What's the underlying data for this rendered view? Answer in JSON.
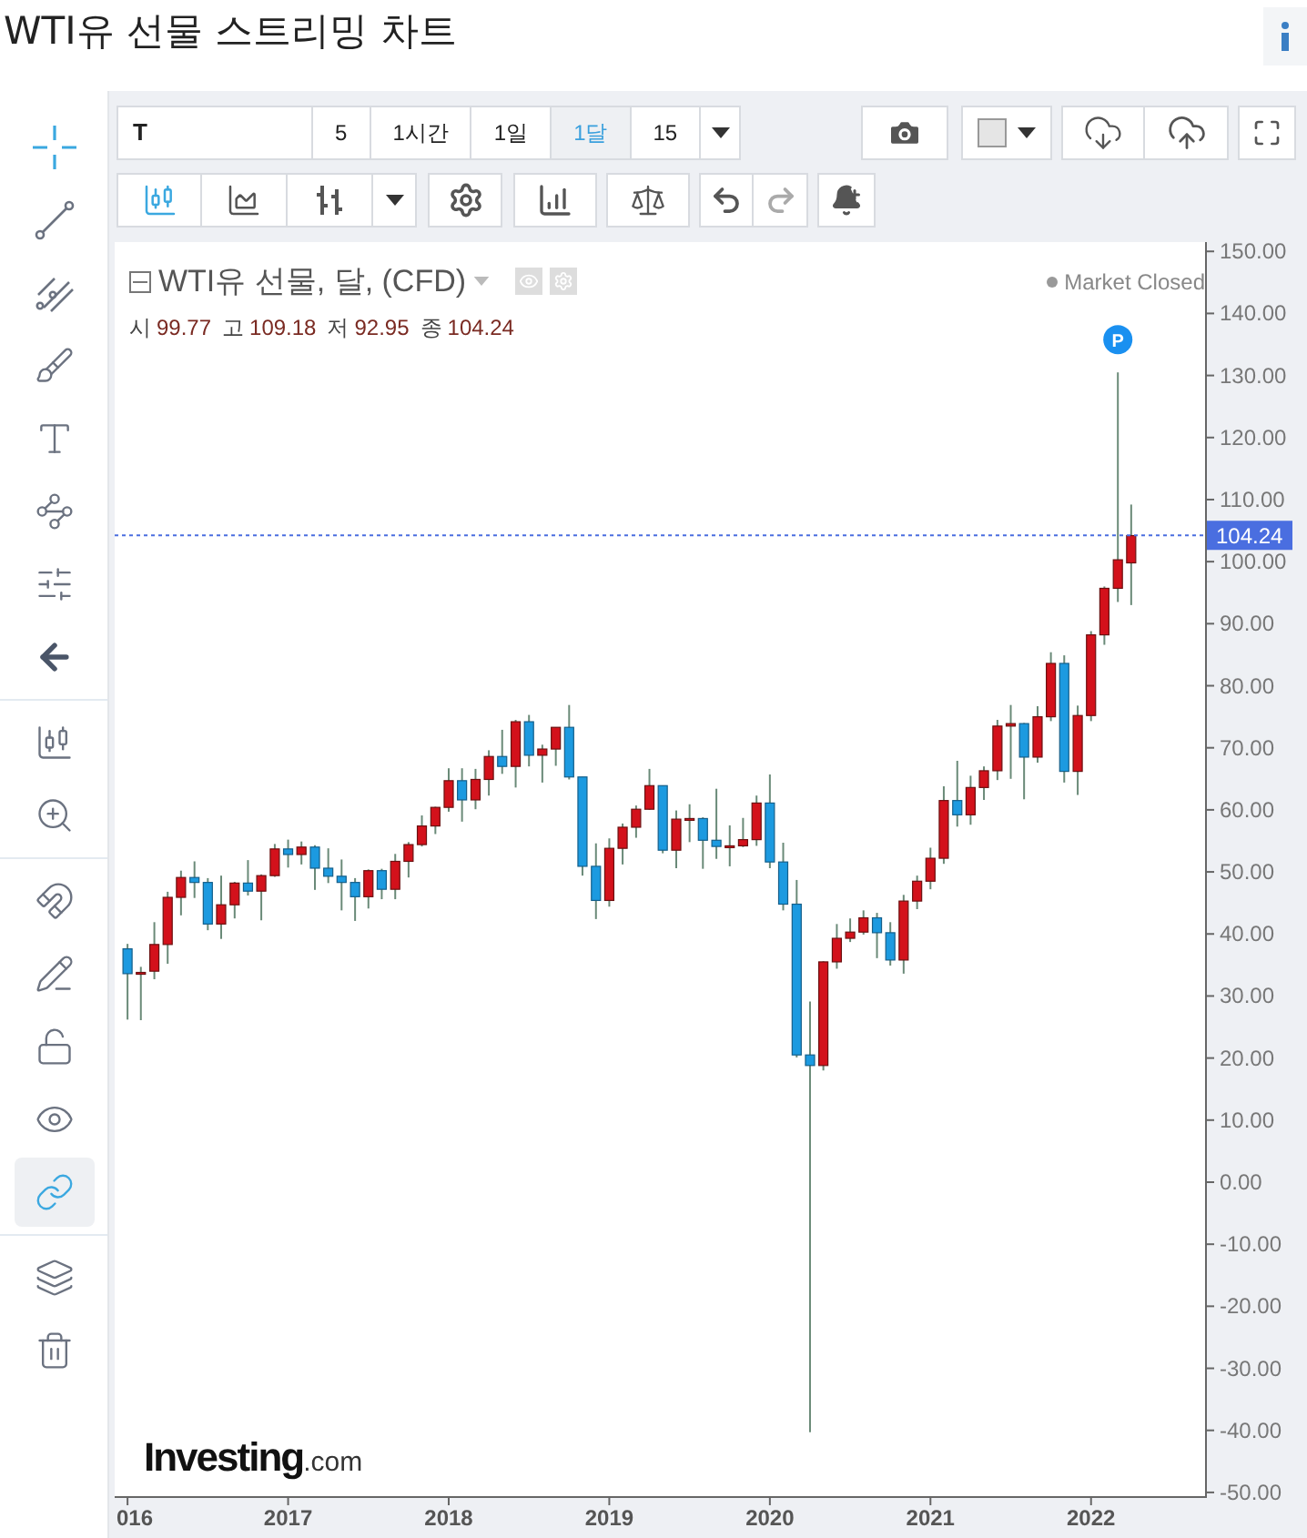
{
  "page_title": "WTI유 선물 스트리밍 차트",
  "sidebar": {
    "groups": [
      {
        "items": [
          {
            "kind": "crosshair",
            "selected": true
          },
          {
            "kind": "trend-line",
            "selected": false
          },
          {
            "kind": "pitchfork",
            "selected": false
          },
          {
            "kind": "brush",
            "selected": false
          },
          {
            "kind": "text",
            "selected": false
          },
          {
            "kind": "pattern",
            "selected": false
          },
          {
            "kind": "fibonacci",
            "selected": false
          },
          {
            "kind": "hide",
            "selected": false
          }
        ]
      },
      {
        "items": [
          {
            "kind": "measure",
            "selected": false
          },
          {
            "kind": "zoom",
            "selected": false
          }
        ]
      },
      {
        "items": [
          {
            "kind": "magnet",
            "on": false
          },
          {
            "kind": "lock-drawing",
            "on": false
          },
          {
            "kind": "lock",
            "on": false
          },
          {
            "kind": "visibility",
            "on": false
          },
          {
            "kind": "link",
            "on": true
          }
        ]
      },
      {
        "items": [
          {
            "kind": "layers"
          },
          {
            "kind": "trash"
          }
        ]
      }
    ]
  },
  "toolbar": {
    "symbol": "T",
    "intervals": [
      {
        "label": "5",
        "selected": false
      },
      {
        "label": "1시간",
        "selected": false
      },
      {
        "label": "1일",
        "selected": false
      },
      {
        "label": "1달",
        "selected": true
      },
      {
        "label": "15",
        "selected": false
      }
    ],
    "chart_types": [
      {
        "kind": "candles",
        "selected": true
      },
      {
        "kind": "area",
        "selected": false
      },
      {
        "kind": "bars",
        "selected": false
      }
    ],
    "undo": {
      "disabled": false
    },
    "redo": {
      "disabled": true
    }
  },
  "legend": {
    "title": "WTI유 선물, 달, (CFD)",
    "status": "Market Closed",
    "ohlc": [
      {
        "label": "시",
        "value": "99.77"
      },
      {
        "label": "고",
        "value": "109.18"
      },
      {
        "label": "저",
        "value": "92.95"
      },
      {
        "label": "종",
        "value": "104.24"
      }
    ]
  },
  "logo": {
    "name": "Investing",
    "suffix": ".com"
  },
  "badge": {
    "label": "P"
  },
  "x_axis_edge_label": "016",
  "chart_data": {
    "type": "candlestick",
    "x": [
      2016.0,
      2016.083,
      2016.167,
      2016.25,
      2016.333,
      2016.417,
      2016.5,
      2016.583,
      2016.667,
      2016.75,
      2016.833,
      2016.917,
      2017.0,
      2017.083,
      2017.167,
      2017.25,
      2017.333,
      2017.417,
      2017.5,
      2017.583,
      2017.667,
      2017.75,
      2017.833,
      2017.917,
      2018.0,
      2018.083,
      2018.167,
      2018.25,
      2018.333,
      2018.417,
      2018.5,
      2018.583,
      2018.667,
      2018.75,
      2018.833,
      2018.917,
      2019.0,
      2019.083,
      2019.167,
      2019.25,
      2019.333,
      2019.417,
      2019.5,
      2019.583,
      2019.667,
      2019.75,
      2019.833,
      2019.917,
      2020.0,
      2020.083,
      2020.167,
      2020.25,
      2020.333,
      2020.417,
      2020.5,
      2020.583,
      2020.667,
      2020.75,
      2020.833,
      2020.917,
      2021.0,
      2021.083,
      2021.167,
      2021.25,
      2021.333,
      2021.417,
      2021.5,
      2021.583,
      2021.667,
      2021.75,
      2021.833,
      2021.917,
      2022.0,
      2022.083,
      2022.167,
      2022.25
    ],
    "xlim": [
      2015.92,
      2022.71
    ],
    "ohlc": [
      [
        37.6,
        38.4,
        26.2,
        33.6
      ],
      [
        33.6,
        34.7,
        26.1,
        33.8
      ],
      [
        34.0,
        41.9,
        32.7,
        38.3
      ],
      [
        38.3,
        46.8,
        35.2,
        45.9
      ],
      [
        45.9,
        50.2,
        43.0,
        49.1
      ],
      [
        49.1,
        51.7,
        45.8,
        48.3
      ],
      [
        48.3,
        49.0,
        40.6,
        41.6
      ],
      [
        41.6,
        49.4,
        39.2,
        44.7
      ],
      [
        44.7,
        48.4,
        42.5,
        48.2
      ],
      [
        48.2,
        51.9,
        46.2,
        46.9
      ],
      [
        46.9,
        49.6,
        42.2,
        49.4
      ],
      [
        49.4,
        54.5,
        49.2,
        53.7
      ],
      [
        53.7,
        55.2,
        50.7,
        52.8
      ],
      [
        52.8,
        54.9,
        51.2,
        54.0
      ],
      [
        54.0,
        54.3,
        47.1,
        50.6
      ],
      [
        50.6,
        53.8,
        48.2,
        49.3
      ],
      [
        49.3,
        52.0,
        43.8,
        48.3
      ],
      [
        48.3,
        49.0,
        42.1,
        46.0
      ],
      [
        46.0,
        50.4,
        44.1,
        50.2
      ],
      [
        50.2,
        50.5,
        45.6,
        47.2
      ],
      [
        47.2,
        52.9,
        45.6,
        51.7
      ],
      [
        51.7,
        54.8,
        49.1,
        54.4
      ],
      [
        54.4,
        59.1,
        54.1,
        57.4
      ],
      [
        57.4,
        60.5,
        56.1,
        60.4
      ],
      [
        60.4,
        66.7,
        59.7,
        64.7
      ],
      [
        64.7,
        66.7,
        58.1,
        61.6
      ],
      [
        61.6,
        66.6,
        60.1,
        64.9
      ],
      [
        64.9,
        69.6,
        62.3,
        68.6
      ],
      [
        68.6,
        72.9,
        65.8,
        67.0
      ],
      [
        67.0,
        74.5,
        63.6,
        74.2
      ],
      [
        74.2,
        75.3,
        67.0,
        68.8
      ],
      [
        68.8,
        70.5,
        64.4,
        69.8
      ],
      [
        69.8,
        73.3,
        67.1,
        73.3
      ],
      [
        73.3,
        76.9,
        64.9,
        65.3
      ],
      [
        65.3,
        65.3,
        49.4,
        50.9
      ],
      [
        50.9,
        54.6,
        42.4,
        45.4
      ],
      [
        45.4,
        55.4,
        44.4,
        53.8
      ],
      [
        53.8,
        57.8,
        51.2,
        57.2
      ],
      [
        57.2,
        60.7,
        55.5,
        60.1
      ],
      [
        60.1,
        66.6,
        60.0,
        63.9
      ],
      [
        63.9,
        63.9,
        53.0,
        53.5
      ],
      [
        53.5,
        59.9,
        50.6,
        58.5
      ],
      [
        58.5,
        60.9,
        54.8,
        58.6
      ],
      [
        58.6,
        58.8,
        50.5,
        55.1
      ],
      [
        55.1,
        63.4,
        52.1,
        54.1
      ],
      [
        54.1,
        57.5,
        50.9,
        54.2
      ],
      [
        54.2,
        58.7,
        54.0,
        55.2
      ],
      [
        55.2,
        62.3,
        54.2,
        61.1
      ],
      [
        61.1,
        65.7,
        50.6,
        51.6
      ],
      [
        51.6,
        54.7,
        43.8,
        44.8
      ],
      [
        44.8,
        48.7,
        20.1,
        20.5
      ],
      [
        20.5,
        29.1,
        -40.3,
        18.8
      ],
      [
        18.8,
        35.6,
        18.0,
        35.5
      ],
      [
        35.5,
        41.6,
        34.4,
        39.3
      ],
      [
        39.3,
        42.5,
        38.7,
        40.3
      ],
      [
        40.3,
        43.8,
        39.9,
        42.6
      ],
      [
        42.6,
        43.4,
        36.1,
        40.2
      ],
      [
        40.2,
        41.9,
        34.9,
        35.8
      ],
      [
        35.8,
        46.3,
        33.6,
        45.3
      ],
      [
        45.3,
        49.4,
        44.0,
        48.5
      ],
      [
        48.5,
        53.9,
        47.2,
        52.2
      ],
      [
        52.2,
        63.8,
        51.3,
        61.5
      ],
      [
        61.5,
        67.9,
        57.3,
        59.2
      ],
      [
        59.2,
        65.5,
        57.6,
        63.6
      ],
      [
        63.6,
        67.0,
        61.6,
        66.3
      ],
      [
        66.3,
        74.5,
        64.8,
        73.5
      ],
      [
        73.5,
        76.9,
        65.0,
        73.9
      ],
      [
        73.9,
        74.0,
        61.7,
        68.5
      ],
      [
        68.5,
        76.7,
        67.6,
        75.0
      ],
      [
        75.0,
        85.4,
        74.3,
        83.6
      ],
      [
        83.6,
        84.9,
        64.4,
        66.2
      ],
      [
        66.2,
        76.8,
        62.4,
        75.2
      ],
      [
        75.2,
        88.8,
        74.3,
        88.2
      ],
      [
        88.2,
        96.0,
        86.6,
        95.7
      ],
      [
        95.7,
        130.5,
        93.5,
        100.3
      ],
      [
        99.8,
        109.2,
        93.0,
        104.2
      ]
    ],
    "ylim": [
      -50.6,
      151.5
    ],
    "yticks": [
      {
        "value": 150,
        "label": "150.00"
      },
      {
        "value": 140,
        "label": "140.00"
      },
      {
        "value": 130,
        "label": "130.00"
      },
      {
        "value": 120,
        "label": "120.00"
      },
      {
        "value": 110,
        "label": "110.00"
      },
      {
        "value": 100,
        "label": "100.00"
      },
      {
        "value": 90,
        "label": "90.00"
      },
      {
        "value": 80,
        "label": "80.00"
      },
      {
        "value": 70,
        "label": "70.00"
      },
      {
        "value": 60,
        "label": "60.00"
      },
      {
        "value": 50,
        "label": "50.00"
      },
      {
        "value": 40,
        "label": "40.00"
      },
      {
        "value": 30,
        "label": "30.00"
      },
      {
        "value": 20,
        "label": "20.00"
      },
      {
        "value": 10,
        "label": "10.00"
      },
      {
        "value": 0,
        "label": "0.00"
      },
      {
        "value": -10,
        "label": "-10.00"
      },
      {
        "value": -20,
        "label": "-20.00"
      },
      {
        "value": -30,
        "label": "-30.00"
      },
      {
        "value": -40,
        "label": "-40.00"
      },
      {
        "value": -50,
        "label": "-50.00"
      }
    ],
    "xticks": [
      {
        "value": 2017,
        "label": "2017"
      },
      {
        "value": 2018,
        "label": "2018"
      },
      {
        "value": 2019,
        "label": "2019"
      },
      {
        "value": 2020,
        "label": "2020"
      },
      {
        "value": 2021,
        "label": "2021"
      },
      {
        "value": 2022,
        "label": "2022"
      }
    ],
    "ref_lines": [
      {
        "axis": "y",
        "value": 104.24,
        "label": "104.24",
        "color": "#4a6ee0"
      }
    ]
  }
}
